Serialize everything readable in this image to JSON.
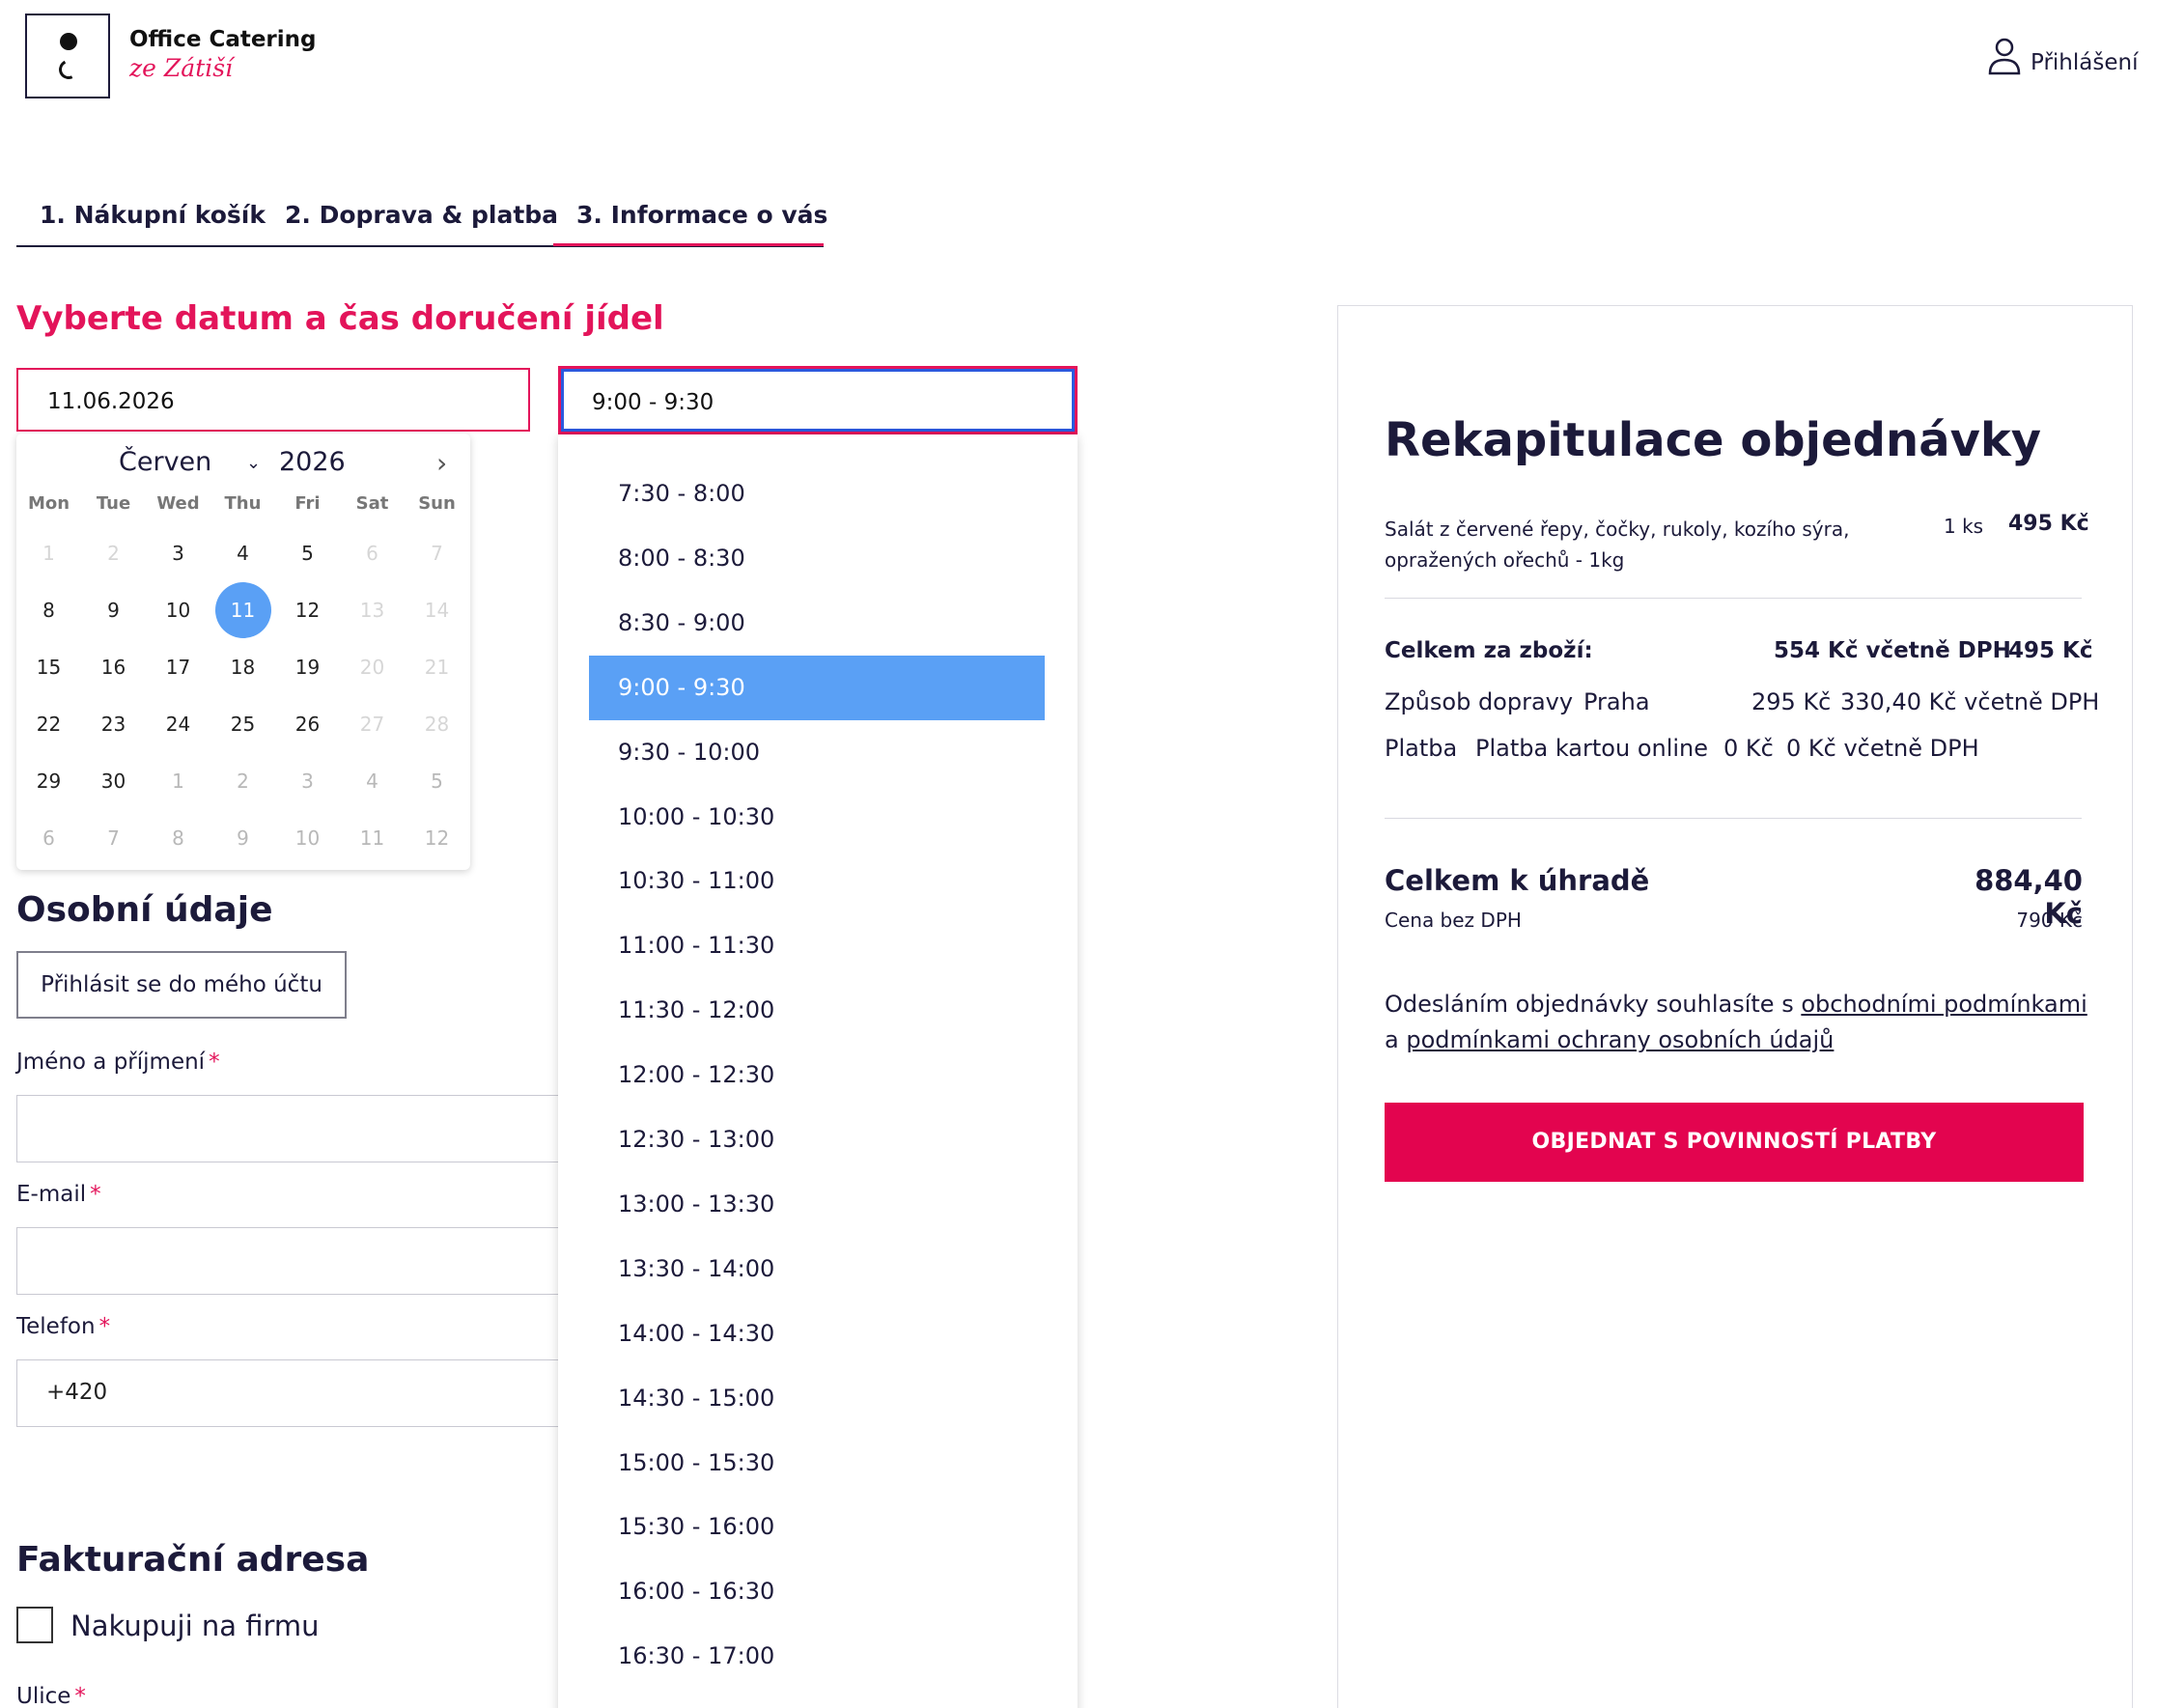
{
  "header": {
    "brand_title": "Office Catering",
    "brand_subtitle": "ze Zátiší",
    "login_label": "Přihlášení"
  },
  "steps": [
    {
      "label": "1.  Nákupní košík"
    },
    {
      "label": "2.  Doprava & platba"
    },
    {
      "label": "3.  Informace o vás",
      "active": true
    }
  ],
  "delivery": {
    "heading": "Vyberte datum a čas doručení jídel",
    "date_value": "11.06.2026",
    "time_value": "9:00 - 9:30"
  },
  "calendar": {
    "month": "Červen",
    "year": "2026",
    "weekdays": [
      "Mon",
      "Tue",
      "Wed",
      "Thu",
      "Fri",
      "Sat",
      "Sun"
    ],
    "weeks": [
      [
        "1",
        "2",
        "3",
        "4",
        "5",
        "6",
        "7"
      ],
      [
        "8",
        "9",
        "10",
        "11",
        "12",
        "13",
        "14"
      ],
      [
        "15",
        "16",
        "17",
        "18",
        "19",
        "20",
        "21"
      ],
      [
        "22",
        "23",
        "24",
        "25",
        "26",
        "27",
        "28"
      ],
      [
        "29",
        "30",
        "1",
        "2",
        "3",
        "4",
        "5"
      ],
      [
        "6",
        "7",
        "8",
        "9",
        "10",
        "11",
        "12"
      ]
    ],
    "selected": "11"
  },
  "time_options": [
    "7:30 - 8:00",
    "8:00 - 8:30",
    "8:30 - 9:00",
    "9:00 - 9:30",
    "9:30 - 10:00",
    "10:00 - 10:30",
    "10:30 - 11:00",
    "11:00 - 11:30",
    "11:30 - 12:00",
    "12:00 - 12:30",
    "12:30 - 13:00",
    "13:00 - 13:30",
    "13:30 - 14:00",
    "14:00 - 14:30",
    "14:30 - 15:00",
    "15:00 - 15:30",
    "15:30 - 16:00",
    "16:00 - 16:30",
    "16:30 - 17:00"
  ],
  "personal": {
    "heading": "Osobní údaje",
    "login_button": "Přihlásit se do mého účtu",
    "name_label": "Jméno a příjmení",
    "email_label": "E-mail",
    "phone_label": "Telefon",
    "phone_value": "+420",
    "required_mark": "*"
  },
  "billing": {
    "heading": "Fakturační adresa",
    "company_checkbox": "Nakupuji na firmu",
    "street_label": "Ulice"
  },
  "summary": {
    "title": "Rekapitulace objednávky",
    "item_name": "Salát z červené řepy, čočky, rukoly, kozího sýra, opražených ořechů - 1kg",
    "item_qty": "1 ks",
    "item_price": "495 Kč",
    "goods_label": "Celkem za zboží:",
    "goods_vat": "554 Kč včetně DPH",
    "goods_price": "495 Kč",
    "shipping_label": "Způsob dopravy",
    "shipping_method": "Praha",
    "shipping_price": "295 Kč",
    "shipping_vat": "330,40 Kč včetně DPH",
    "payment_label": "Platba",
    "payment_method": "Platba kartou online",
    "payment_price": "0 Kč",
    "payment_vat": "0 Kč včetně DPH",
    "total_label": "Celkem k úhradě",
    "total_value": "884,40 Kč",
    "no_vat_label": "Cena bez DPH",
    "no_vat_value": "790 Kč",
    "terms_prefix": "Odesláním objednávky souhlasíte s",
    "terms_link": "obchodními podmínkami",
    "terms_and": "a",
    "privacy_link": "podmínkami ochrany osobních údajů",
    "order_button": "OBJEDNAT S POVINNOSTÍ PLATBY"
  },
  "colors": {
    "accent": "#e3145a",
    "selected_blue": "#5aa0f5",
    "text": "#1c1a3a"
  }
}
